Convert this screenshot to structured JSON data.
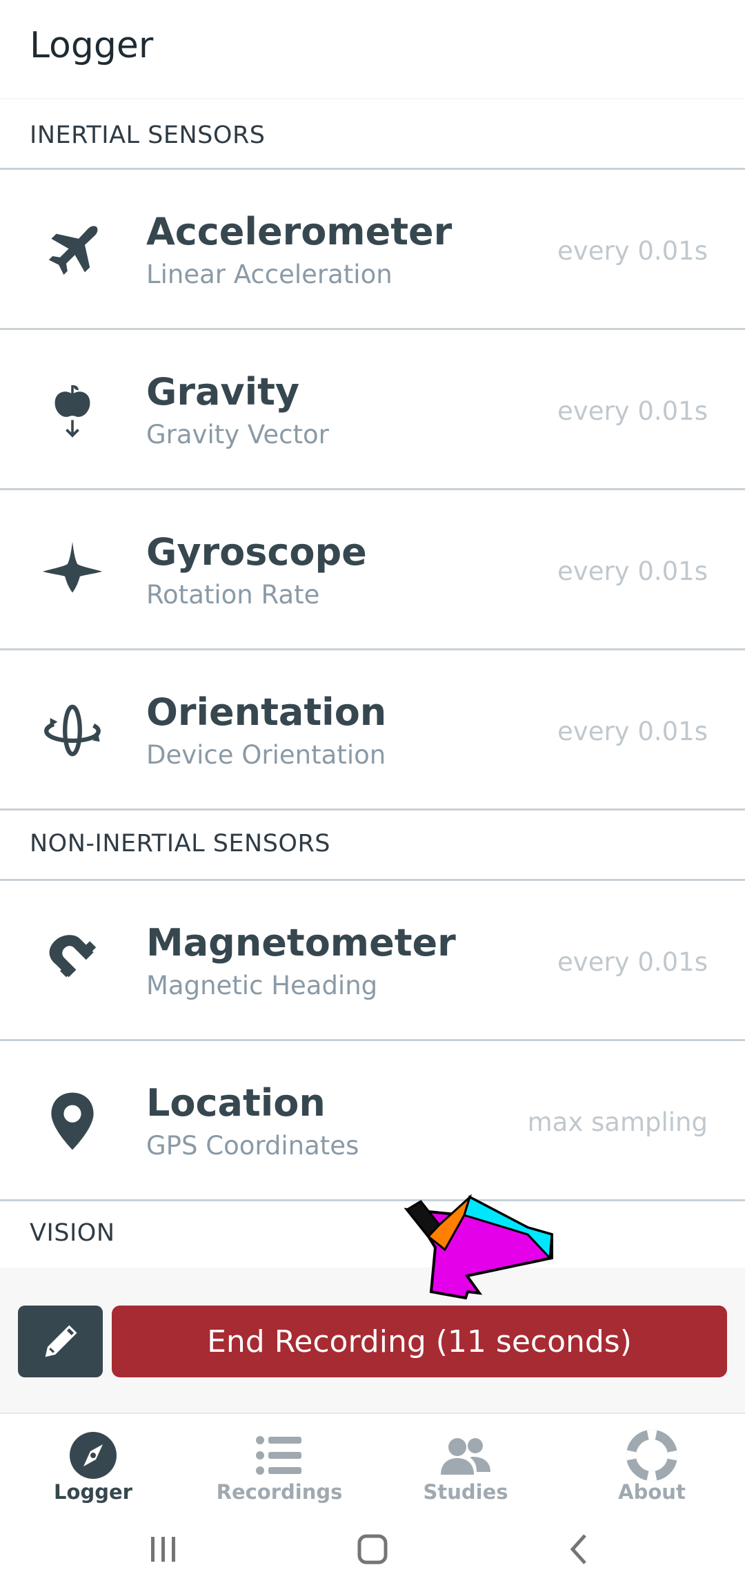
{
  "header": {
    "title": "Logger"
  },
  "sections": {
    "inertial": "INERTIAL SENSORS",
    "non_inertial": "NON-INERTIAL SENSORS",
    "vision": "VISION"
  },
  "sensors": [
    {
      "name": "Accelerometer",
      "sub": "Linear Acceleration",
      "rate": "every 0.01s",
      "icon": "airplane-icon"
    },
    {
      "name": "Gravity",
      "sub": "Gravity Vector",
      "rate": "every 0.01s",
      "icon": "apple-falling-icon"
    },
    {
      "name": "Gyroscope",
      "sub": "Rotation Rate",
      "rate": "every 0.01s",
      "icon": "spinning-top-icon"
    },
    {
      "name": "Orientation",
      "sub": "Device Orientation",
      "rate": "every 0.01s",
      "icon": "orientation-icon"
    },
    {
      "name": "Magnetometer",
      "sub": "Magnetic Heading",
      "rate": "every 0.01s",
      "icon": "magnet-icon"
    },
    {
      "name": "Location",
      "sub": "GPS Coordinates",
      "rate": "max sampling",
      "icon": "map-pin-icon"
    }
  ],
  "actions": {
    "end_recording": "End Recording (11 seconds)",
    "edit_icon": "pencil-icon"
  },
  "nav": [
    {
      "label": "Logger",
      "icon": "compass-icon",
      "active": true
    },
    {
      "label": "Recordings",
      "icon": "list-icon",
      "active": false
    },
    {
      "label": "Studies",
      "icon": "users-icon",
      "active": false
    },
    {
      "label": "About",
      "icon": "lifebuoy-icon",
      "active": false
    }
  ],
  "colors": {
    "primary_text": "#37474f",
    "end_button": "#a72b33",
    "rate_text": "#c0c8ce",
    "inactive_nav": "#a0a9b0"
  }
}
